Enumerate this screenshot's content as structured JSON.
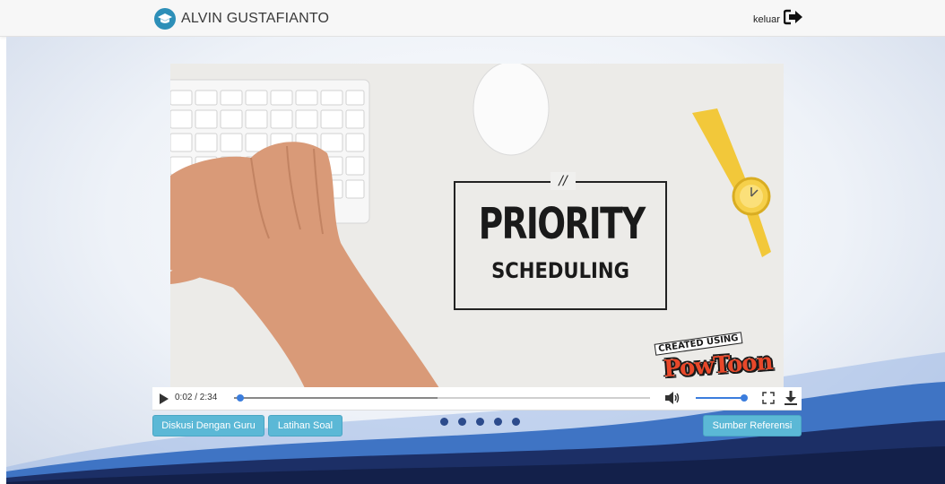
{
  "header": {
    "user_name": "ALVIN GUSTAFIANTO",
    "logout_label": "keluar",
    "logo_icon": "graduation-cap-icon",
    "logout_icon": "sign-out-icon"
  },
  "video": {
    "title_main": "PRIORITY",
    "title_sub": "SCHEDULING",
    "title_slashes": "//",
    "badge_created": "CREATED USING",
    "badge_brand": "PowToon",
    "current_time": "0:02 / 2:34",
    "progress_fraction": 0.013,
    "buffered_fraction": 0.49,
    "volume_fraction": 1.0
  },
  "buttons": {
    "discuss": "Diskusi Dengan Guru",
    "quiz": "Latihan Soal",
    "reference": "Sumber Referensi"
  },
  "pager": {
    "count": 5
  },
  "colors": {
    "accent": "#5bb8d6",
    "brand_icon": "#2d8fb8",
    "wave_dark": "#1c2f66",
    "wave_light": "#3f74c4",
    "player_accent": "#3b7ddd"
  }
}
